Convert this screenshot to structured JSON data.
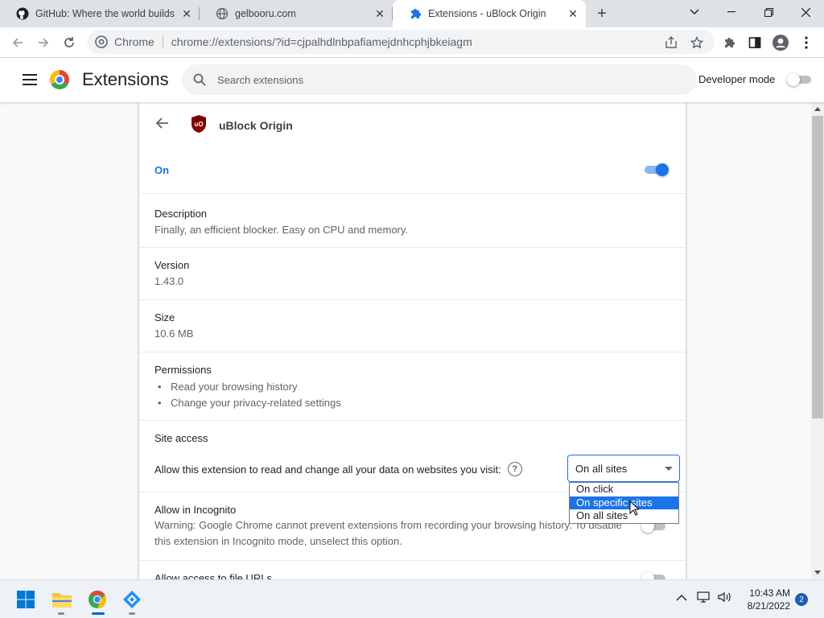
{
  "tabs": [
    {
      "title": "GitHub: Where the world builds s",
      "icon": "github-icon"
    },
    {
      "title": "gelbooru.com",
      "icon": "globe-icon"
    },
    {
      "title": "Extensions - uBlock Origin",
      "icon": "puzzle-icon",
      "active": true
    }
  ],
  "omnibox": {
    "site_label": "Chrome",
    "url": "chrome://extensions/?id=cjpalhdlnbpafiamejdnhcphjbkeiagm"
  },
  "header": {
    "title": "Extensions",
    "search_placeholder": "Search extensions",
    "developer_mode_label": "Developer mode",
    "developer_mode_on": false
  },
  "extension": {
    "name": "uBlock Origin",
    "enabled_label": "On",
    "enabled": true,
    "description_label": "Description",
    "description": "Finally, an efficient blocker. Easy on CPU and memory.",
    "version_label": "Version",
    "version": "1.43.0",
    "size_label": "Size",
    "size": "10.6 MB",
    "permissions_label": "Permissions",
    "permissions": [
      "Read your browsing history",
      "Change your privacy-related settings"
    ],
    "site_access_label": "Site access",
    "site_access_prompt": "Allow this extension to read and change all your data on websites you visit:",
    "site_access_value": "On all sites",
    "site_access_options": [
      "On click",
      "On specific sites",
      "On all sites"
    ],
    "site_access_highlighted": "On specific sites",
    "incognito_label": "Allow in Incognito",
    "incognito_warning": "Warning: Google Chrome cannot prevent extensions from recording your browsing history. To disable this extension in Incognito mode, unselect this option.",
    "file_urls_label": "Allow access to file URLs"
  },
  "taskbar": {
    "time": "10:43 AM",
    "date": "8/21/2022",
    "notifications": "2"
  },
  "colors": {
    "accent": "#1a73e8",
    "tabstrip": "#dee1e6",
    "ublock_red": "#800000"
  }
}
